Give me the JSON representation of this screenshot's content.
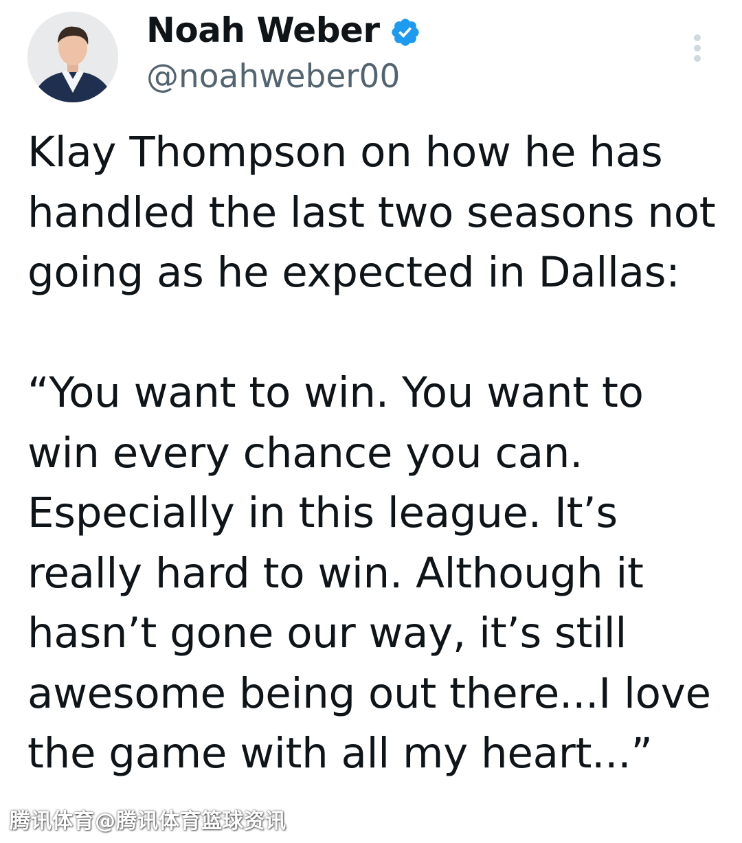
{
  "author": {
    "display_name": "Noah Weber",
    "handle": "@noahweber00",
    "avatar_icon": "profile-photo",
    "verified_icon": "verified-badge-icon",
    "verified_color": "#1d9bf0"
  },
  "menu": {
    "icon": "more-options-icon"
  },
  "tweet": {
    "text": "Klay Thompson on how he has handled the last two seasons not going as he expected in Dallas:\n\n“You want to win. You want to win every chance you can. Especially in this league. It’s really hard to win. Although it hasn’t gone our way, it’s still awesome being out there...I love the game with all my heart...”"
  },
  "watermark": {
    "text": "腾讯体育@腾讯体育篮球资讯"
  }
}
